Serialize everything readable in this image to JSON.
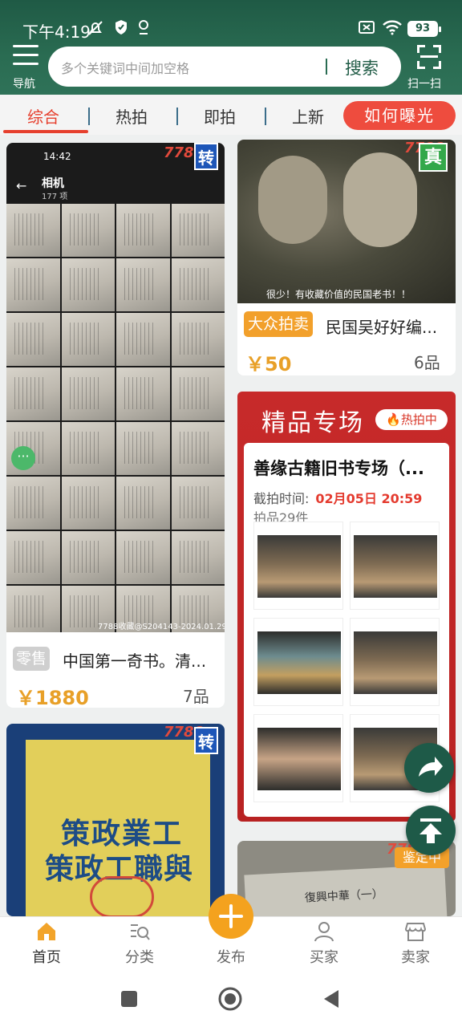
{
  "status_bar": {
    "time": "下午4:19",
    "battery": "93"
  },
  "header": {
    "nav_label": "导航",
    "search_placeholder": "多个关键词中间加空格",
    "search_button": "搜索",
    "scan_label": "扫一扫"
  },
  "tabs": {
    "items": [
      "综合",
      "热拍",
      "即拍",
      "上新"
    ],
    "active_index": 0,
    "how_button": "如何曝光"
  },
  "feed": {
    "card1": {
      "corner_tag": "转",
      "watermark": "7788",
      "photo_header": "14:42",
      "album_title": "相机",
      "album_count": "177 项",
      "caption": "7788收藏@S204143-2024.01.29",
      "badge": "零售",
      "title": "中国第一奇书。清...",
      "price": "￥1880",
      "count": "7品"
    },
    "card2": {
      "corner_tag": "真",
      "watermark": "7788",
      "caption": "很少！有收藏价值的民国老书！！",
      "badge": "大众拍卖",
      "title": "民国吴好好编...",
      "price": "￥50",
      "count": "6品"
    },
    "boutique": {
      "heading": "精品专场",
      "hot_label": "热拍中",
      "title": "善缘古籍旧书专场（...",
      "deadline_label": "截拍时间:",
      "deadline_value": "02月05日 20:59",
      "lots": "拍品29件"
    },
    "card3": {
      "corner_tag": "转",
      "watermark": "7788",
      "book_text_top": "策政業工",
      "book_text_bottom": "策政工職與"
    },
    "card4": {
      "corner_tag": "鉴定中",
      "watermark": "7788",
      "book_label": "復興中華（一）"
    }
  },
  "bottom_nav": {
    "items": [
      "首页",
      "分类",
      "发布",
      "买家",
      "卖家"
    ],
    "active_index": 0
  },
  "colors": {
    "brand_green": "#1f5a45",
    "accent_red": "#e6402e",
    "price_orange": "#e8a028",
    "publish_orange": "#f4a21e"
  }
}
